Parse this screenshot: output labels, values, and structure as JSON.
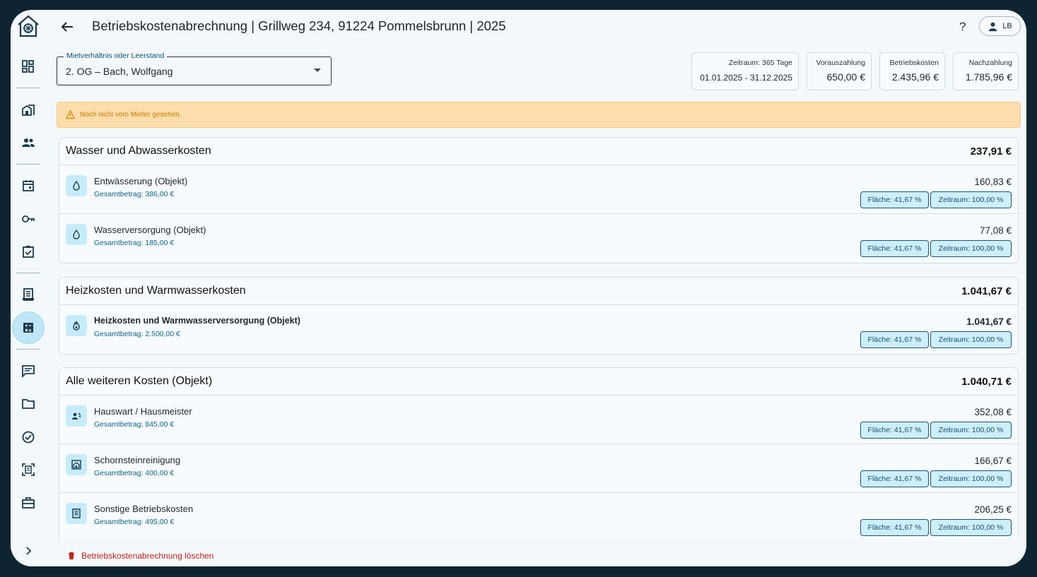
{
  "header": {
    "title": "Betriebskostenabrechnung | Grillweg 234, 91224 Pommelsbrunn | 2025",
    "help": "?",
    "user_initials": "LB"
  },
  "selector": {
    "label": "Mietverhältnis oder Leerstand",
    "value": "2. OG – Bach, Wolfgang"
  },
  "stats": {
    "period_label": "Zeitraum: 365 Tage",
    "period_value": "01.01.2025 - 31.12.2025",
    "prepayment_label": "Vorauszahlung",
    "prepayment_value": "650,00 €",
    "costs_label": "Betriebskosten",
    "costs_value": "2.435,96 €",
    "balance_label": "Nachzahlung",
    "balance_value": "1.785,96 €"
  },
  "warning": "Noch nicht vom Mieter gesehen.",
  "groups": [
    {
      "title": "Wasser und Abwasserkosten",
      "total": "237,91 €",
      "items": [
        {
          "name": "Entwässerung (Objekt)",
          "sub": "Gesamtbetrag: 386,00 €",
          "amount": "160,83 €",
          "area": "Fläche: 41,67 %",
          "time": "Zeitraum: 100,00 %",
          "icon": "water-drop-icon"
        },
        {
          "name": "Wasserversorgung (Objekt)",
          "sub": "Gesamtbetrag: 185,00 €",
          "amount": "77,08 €",
          "area": "Fläche: 41,67 %",
          "time": "Zeitraum: 100,00 %",
          "icon": "water-drop-icon"
        }
      ]
    },
    {
      "title": "Heizkosten und Warmwasserkosten",
      "total": "1.041,67 €",
      "items": [
        {
          "name": "Heizkosten und Warmwasserversorgung (Objekt)",
          "sub": "Gesamtbetrag: 2.500,00 €",
          "amount": "1.041,67 €",
          "area": "Fläche: 41,67 %",
          "time": "Zeitraum: 100,00 %",
          "icon": "flame-icon"
        }
      ]
    },
    {
      "title": "Alle weiteren Kosten (Objekt)",
      "total": "1.040,71 €",
      "items": [
        {
          "name": "Hauswart / Hausmeister",
          "sub": "Gesamtbetrag: 845,00 €",
          "amount": "352,08 €",
          "area": "Fläche: 41,67 %",
          "time": "Zeitraum: 100,00 %",
          "icon": "caretaker-icon"
        },
        {
          "name": "Schornsteinreinigung",
          "sub": "Gesamtbetrag: 400,00 €",
          "amount": "166,67 €",
          "area": "Fläche: 41,67 %",
          "time": "Zeitraum: 100,00 %",
          "icon": "chimney-icon"
        },
        {
          "name": "Sonstige Betriebskosten",
          "sub": "Gesamtbetrag: 495,00 €",
          "amount": "206,25 €",
          "area": "Fläche: 41,67 %",
          "time": "Zeitraum: 100,00 %",
          "icon": "receipt-icon"
        }
      ]
    }
  ],
  "delete_label": "Betriebskostenabrechnung löschen",
  "colors": {
    "accent": "#0f6385",
    "warning_bg": "#fdddab",
    "danger": "#c0221f",
    "chip_bg": "#cdeefb"
  }
}
